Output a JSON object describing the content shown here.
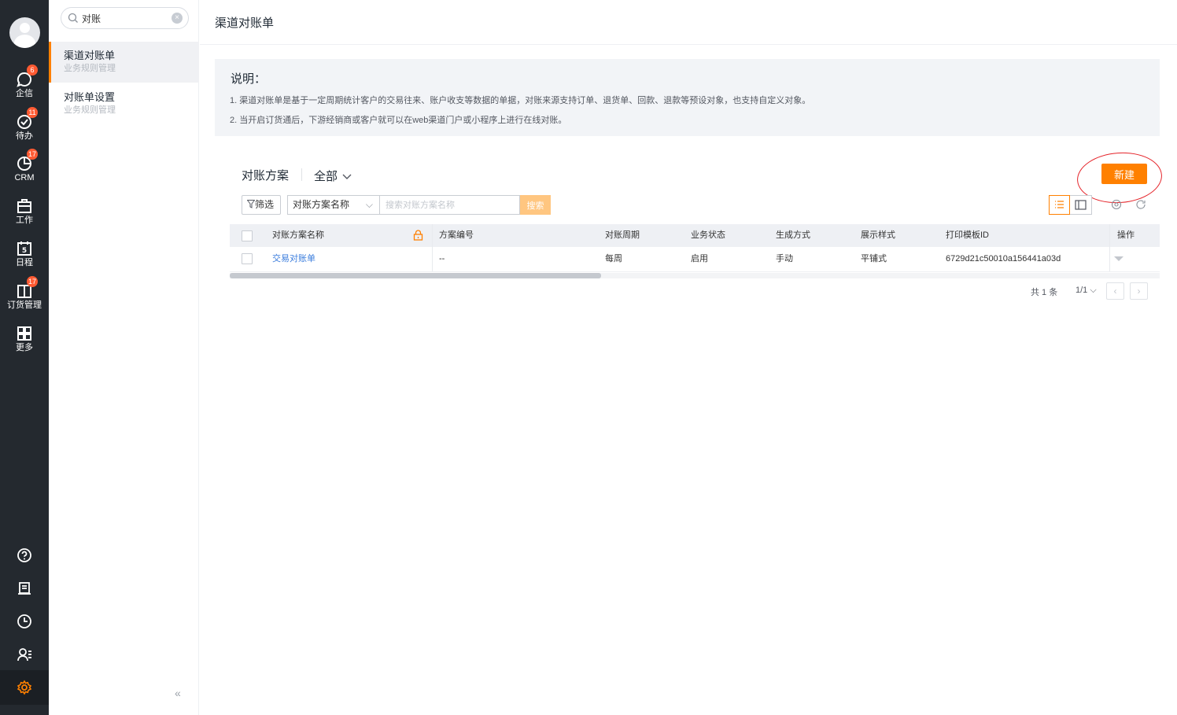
{
  "rail": {
    "items": [
      {
        "label": "企信",
        "badge": "6"
      },
      {
        "label": "待办",
        "badge": "11"
      },
      {
        "label": "CRM",
        "badge": "17"
      },
      {
        "label": "工作",
        "badge": ""
      },
      {
        "label": "日程",
        "badge": "",
        "day": "5"
      },
      {
        "label": "订货管理",
        "badge": "17"
      },
      {
        "label": "更多",
        "badge": ""
      }
    ]
  },
  "sidebar": {
    "search_value": "对账",
    "items": [
      {
        "title": "渠道对账单",
        "subtitle": "业务规则管理",
        "active": true
      },
      {
        "title": "对账单设置",
        "subtitle": "业务规则管理",
        "active": false
      }
    ],
    "collapse": "«"
  },
  "main": {
    "title": "渠道对账单",
    "note": {
      "heading": "说明：",
      "line1": "1. 渠道对账单是基于一定周期统计客户的交易往来、账户收支等数据的单据，对账来源支持订单、退货单、回款、退款等预设对象，也支持自定义对象。",
      "line2": "2. 当开启订货通后，下游经销商或客户就可以在web渠道门户或小程序上进行在线对账。"
    },
    "scheme": {
      "title": "对账方案",
      "filter": "全部"
    },
    "new_button": "新建",
    "toolbar": {
      "filter_label": "筛选",
      "field_select": "对账方案名称",
      "search_placeholder": "搜索对账方案名称",
      "search_button": "搜索"
    },
    "table": {
      "headers": [
        "对账方案名称",
        "方案编号",
        "对账周期",
        "业务状态",
        "生成方式",
        "展示样式",
        "打印模板ID",
        "操作"
      ],
      "rows": [
        {
          "name": "交易对账单",
          "code": "--",
          "period": "每周",
          "status": "启用",
          "method": "手动",
          "style": "平铺式",
          "template_id": "6729d21c50010a156441a03d"
        }
      ]
    },
    "pager": {
      "total": "共 1 条",
      "page": "1/1",
      "prev": "‹",
      "next": "›"
    }
  },
  "colors": {
    "accent": "#ff8000",
    "rail_bg": "#24292f",
    "link": "#3b7ddd",
    "annotation": "#e5242a"
  }
}
